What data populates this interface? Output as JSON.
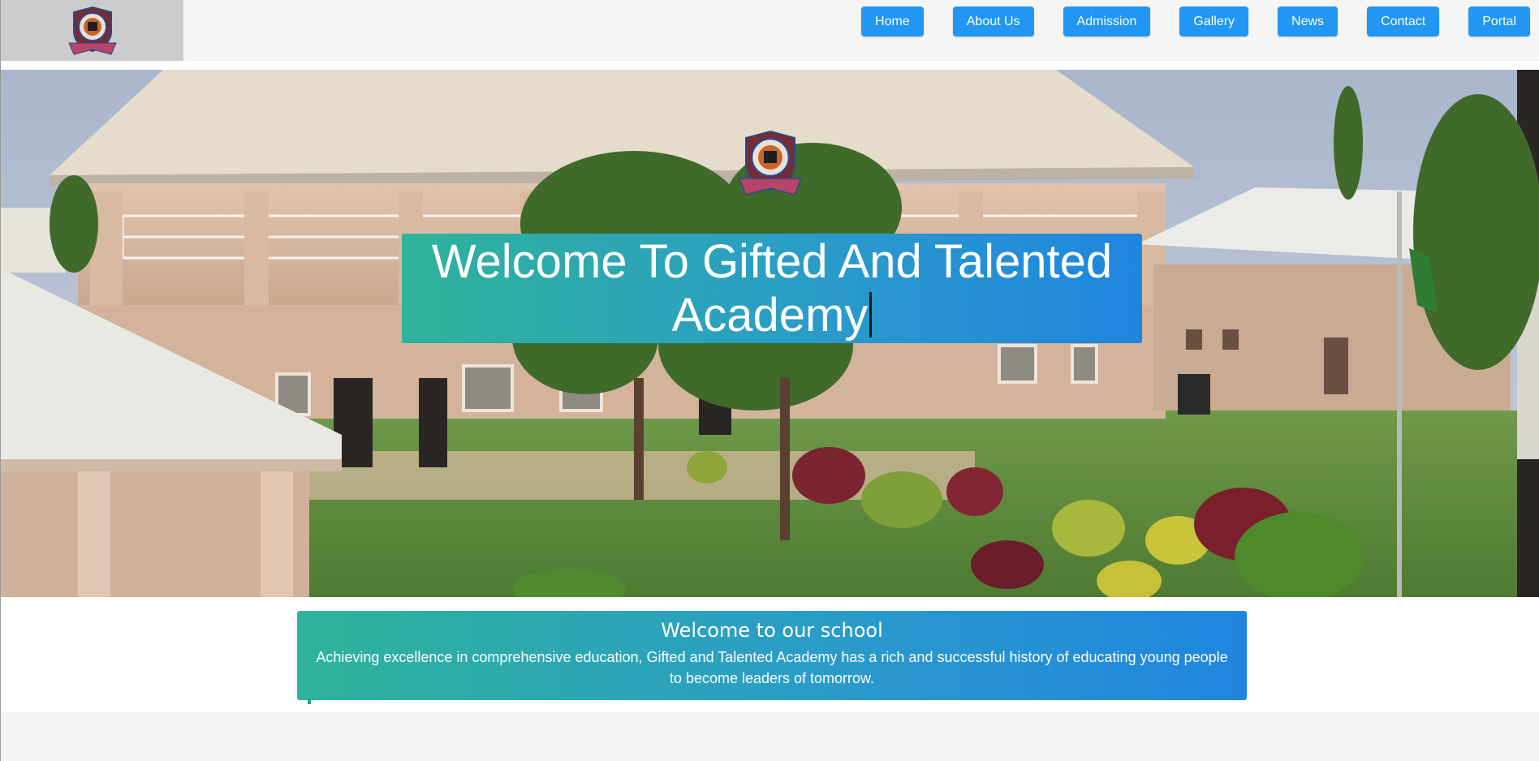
{
  "header": {
    "logo_alt_icon": "school-crest-icon",
    "nav": [
      {
        "label": "Home"
      },
      {
        "label": "About Us"
      },
      {
        "label": "Admission"
      },
      {
        "label": "Gallery"
      },
      {
        "label": "News"
      },
      {
        "label": "Contact"
      },
      {
        "label": "Portal"
      }
    ]
  },
  "hero": {
    "title": "Welcome To Gifted And Talented Academy",
    "crest_icon": "school-crest-icon"
  },
  "welcome": {
    "heading": "Welcome to our school",
    "text": "Achieving excellence in comprehensive education, Gifted and Talented Academy has a rich and successful history of educating young people to become leaders of tomorrow."
  },
  "colors": {
    "nav_button": "#2196f3",
    "gradient_start": "#2fb39a",
    "gradient_end": "#1f85e0",
    "logo_box": "#cccccc"
  }
}
